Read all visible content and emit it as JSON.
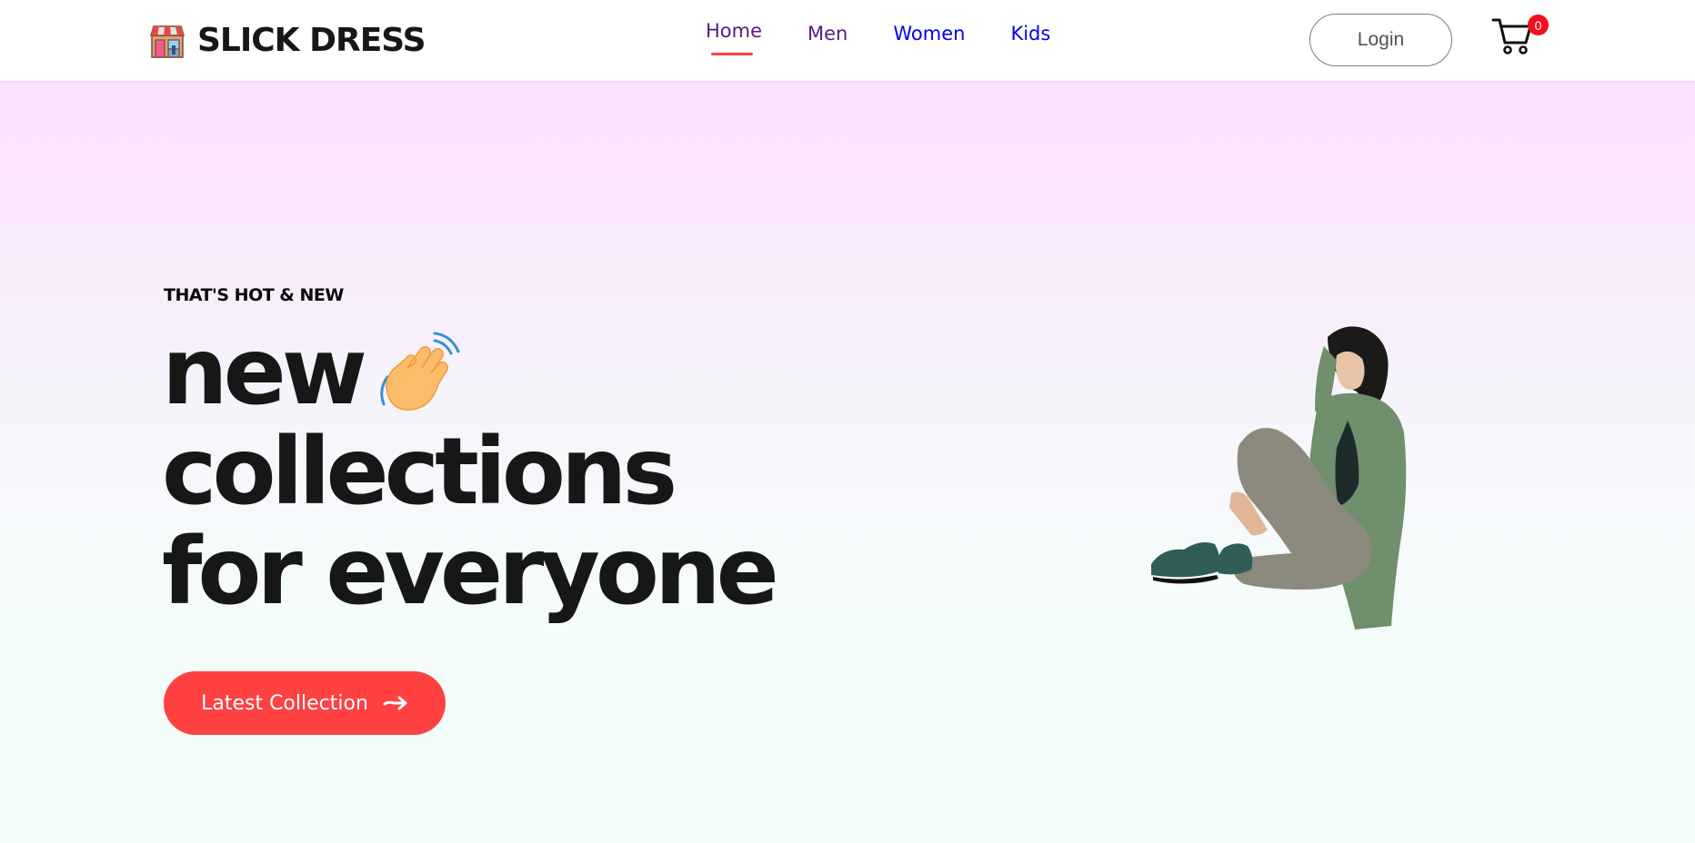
{
  "header": {
    "brand_name": "SLICK DRESS",
    "brand_logo_icon": "storefront-icon",
    "nav": [
      {
        "label": "Home",
        "active": true
      },
      {
        "label": "Men",
        "active": false
      },
      {
        "label": "Women",
        "active": false
      },
      {
        "label": "Kids",
        "active": false
      }
    ],
    "login_label": "Login",
    "cart_icon": "shopping-cart-icon",
    "cart_count": "0"
  },
  "hero": {
    "eyebrow": "THAT'S HOT & NEW",
    "headline_line1": "new",
    "headline_line2": "collections",
    "headline_line3": "for everyone",
    "wave_icon": "waving-hand-icon",
    "cta_label": "Latest Collection",
    "cta_icon": "arrow-right-icon",
    "image": "model-sitting-photo"
  },
  "colors": {
    "accent": "#ff4141",
    "text_dark": "#171717",
    "link_visited": "#551a8b",
    "link": "#0000ee",
    "hero_gradient_top": "#fde1ff",
    "hero_gradient_bottom": "#f3fdf9",
    "badge": "#f0101f"
  }
}
